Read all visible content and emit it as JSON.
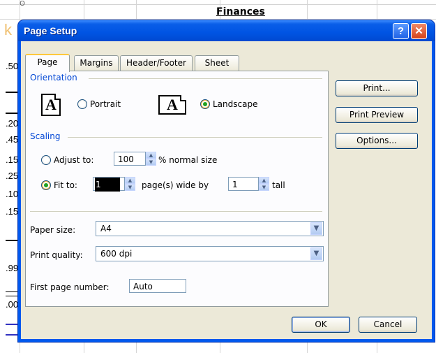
{
  "spreadsheet": {
    "title": "Finances",
    "col_letter": "k",
    "cells": [
      ".50",
      ".20",
      ".45",
      ".15",
      ".25",
      ".10",
      ".15",
      ".99",
      ".00"
    ]
  },
  "dialog": {
    "title": "Page Setup",
    "help_glyph": "?",
    "close_glyph": "✕"
  },
  "tabs": [
    "Page",
    "Margins",
    "Header/Footer",
    "Sheet"
  ],
  "orientation": {
    "label": "Orientation",
    "icon_letter": "A",
    "portrait": {
      "label": "Portrait",
      "selected": false
    },
    "landscape": {
      "label": "Landscape",
      "selected": true
    }
  },
  "scaling": {
    "label": "Scaling",
    "adjust_to": {
      "label": "Adjust to:",
      "value": "100",
      "suffix": "% normal size",
      "selected": false
    },
    "fit_to": {
      "label": "Fit to:",
      "wide_value": "1",
      "wide_suffix": "page(s) wide by",
      "tall_value": "1",
      "tall_suffix": "tall",
      "selected": true
    }
  },
  "paper_size": {
    "label": "Paper size:",
    "value": "A4"
  },
  "print_quality": {
    "label": "Print quality:",
    "value": "600 dpi"
  },
  "first_page_number": {
    "label": "First page number:",
    "value": "Auto"
  },
  "side_buttons": {
    "print": "Print...",
    "print_preview": "Print Preview",
    "options": "Options..."
  },
  "footer_buttons": {
    "ok": "OK",
    "cancel": "Cancel"
  },
  "colors": {
    "titlebar": "#0054e3",
    "dialog_bg": "#ece9d8",
    "group_label": "#0046d5",
    "radio_dot": "#21a121"
  }
}
